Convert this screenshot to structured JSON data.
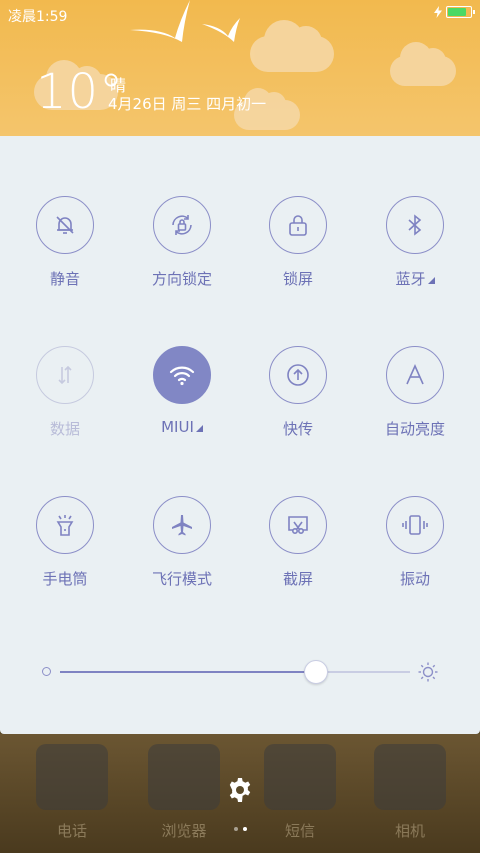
{
  "status": {
    "time": "凌晨1:59",
    "battery_level": 0.8
  },
  "weather": {
    "temperature": "10°",
    "condition": "晴",
    "date": "4月26日 周三 四月初一"
  },
  "toggles": [
    {
      "label": "静音",
      "icon": "bell-off-icon",
      "state": "off"
    },
    {
      "label": "方向锁定",
      "icon": "rotation-lock-icon",
      "state": "off"
    },
    {
      "label": "锁屏",
      "icon": "lock-icon",
      "state": "off"
    },
    {
      "label": "蓝牙",
      "icon": "bluetooth-icon",
      "state": "off"
    },
    {
      "label": "数据",
      "icon": "mobile-data-icon",
      "state": "disabled"
    },
    {
      "label": "MIUI",
      "icon": "wifi-icon",
      "state": "on"
    },
    {
      "label": "快传",
      "icon": "upload-icon",
      "state": "off"
    },
    {
      "label": "自动亮度",
      "icon": "auto-brightness-icon",
      "state": "off"
    },
    {
      "label": "手电筒",
      "icon": "flashlight-icon",
      "state": "off"
    },
    {
      "label": "飞行模式",
      "icon": "airplane-icon",
      "state": "off"
    },
    {
      "label": "截屏",
      "icon": "screenshot-icon",
      "state": "off"
    },
    {
      "label": "振动",
      "icon": "vibrate-icon",
      "state": "off"
    }
  ],
  "brightness": {
    "level": 0.73
  },
  "dock": [
    {
      "label": "电话",
      "icon": "phone-icon"
    },
    {
      "label": "浏览器",
      "icon": "browser-icon"
    },
    {
      "label": "短信",
      "icon": "message-icon"
    },
    {
      "label": "相机",
      "icon": "camera-icon"
    }
  ],
  "colors": {
    "accent": "#8187c5",
    "panel_bg": "#eaf0f3",
    "header_bg": "#f2b94e"
  }
}
